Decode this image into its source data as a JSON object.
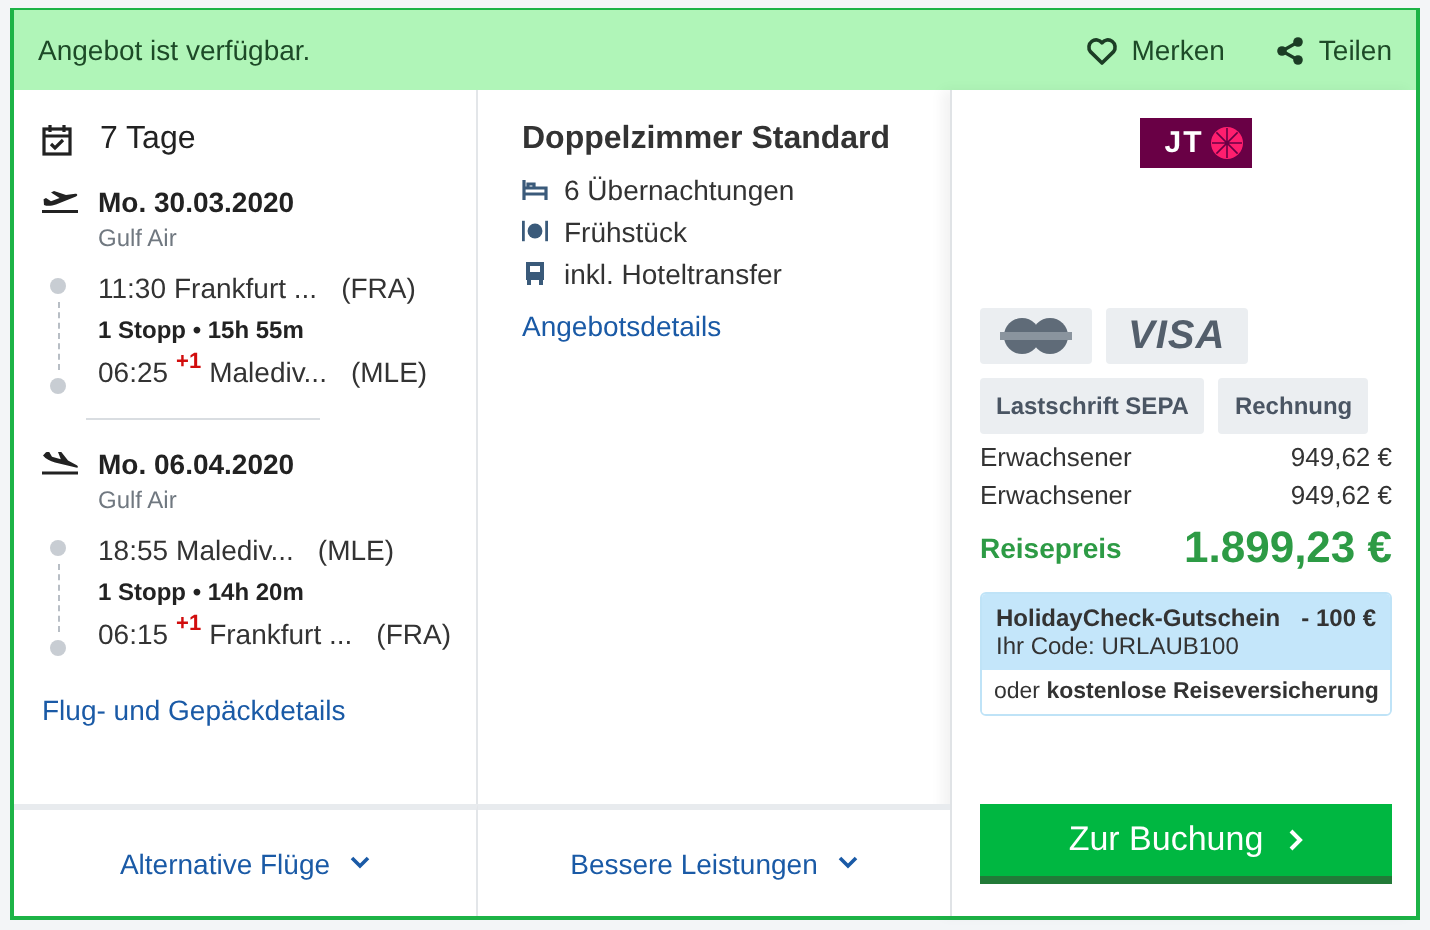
{
  "header": {
    "status": "Angebot ist verfügbar.",
    "actions": [
      {
        "kind": "heart",
        "label": "Merken"
      },
      {
        "kind": "share",
        "label": "Teilen"
      }
    ]
  },
  "trip": {
    "duration": "7 Tage",
    "legs": [
      {
        "kind": "outbound",
        "date": "Mo. 30.03.2020",
        "airline": "Gulf Air",
        "departure": {
          "time": "11:30",
          "place": "Frankfurt ...",
          "code": "(FRA)"
        },
        "stops": "1 Stopp • 15h 55m",
        "arrival": {
          "time": "06:25",
          "day_offset": "+1",
          "place": "Malediv...",
          "code": "(MLE)"
        }
      },
      {
        "kind": "return",
        "date": "Mo. 06.04.2020",
        "airline": "Gulf Air",
        "departure": {
          "time": "18:55",
          "place": "Malediv...",
          "code": "(MLE)"
        },
        "stops": "1 Stopp • 14h 20m",
        "arrival": {
          "time": "06:15",
          "day_offset": "+1",
          "place": "Frankfurt ...",
          "code": "(FRA)"
        }
      }
    ],
    "details_link": "Flug- und Gepäckdetails",
    "more_button": "Alternative Flüge"
  },
  "hotel": {
    "room": "Doppelzimmer Standard",
    "features": [
      {
        "kind": "bed",
        "label": "6 Übernachtungen"
      },
      {
        "kind": "meal",
        "label": "Frühstück"
      },
      {
        "kind": "bus",
        "label": "inkl. Hoteltransfer"
      }
    ],
    "details_link": "Angebotsdetails",
    "more_button": "Bessere Leistungen"
  },
  "booking": {
    "operator_logo": "JT",
    "payment_methods": [
      {
        "kind": "mastercard"
      },
      {
        "kind": "logo",
        "label": "VISA"
      },
      {
        "kind": "label",
        "label": "Lastschrift SEPA"
      },
      {
        "kind": "label",
        "label": "Rechnung"
      }
    ],
    "prices": [
      {
        "label": "Erwachsener",
        "amount": "949,62 €"
      },
      {
        "label": "Erwachsener",
        "amount": "949,62 €"
      }
    ],
    "total": {
      "label": "Reisepreis",
      "amount": "1.899,23 €"
    },
    "voucher": {
      "title": "HolidayCheck-Gutschein",
      "discount": "- 100 €",
      "code": "Ihr Code: URLAUB100",
      "note": "oder **kostenlose Reiseversicherung**"
    },
    "book_button": "Zur Buchung"
  }
}
